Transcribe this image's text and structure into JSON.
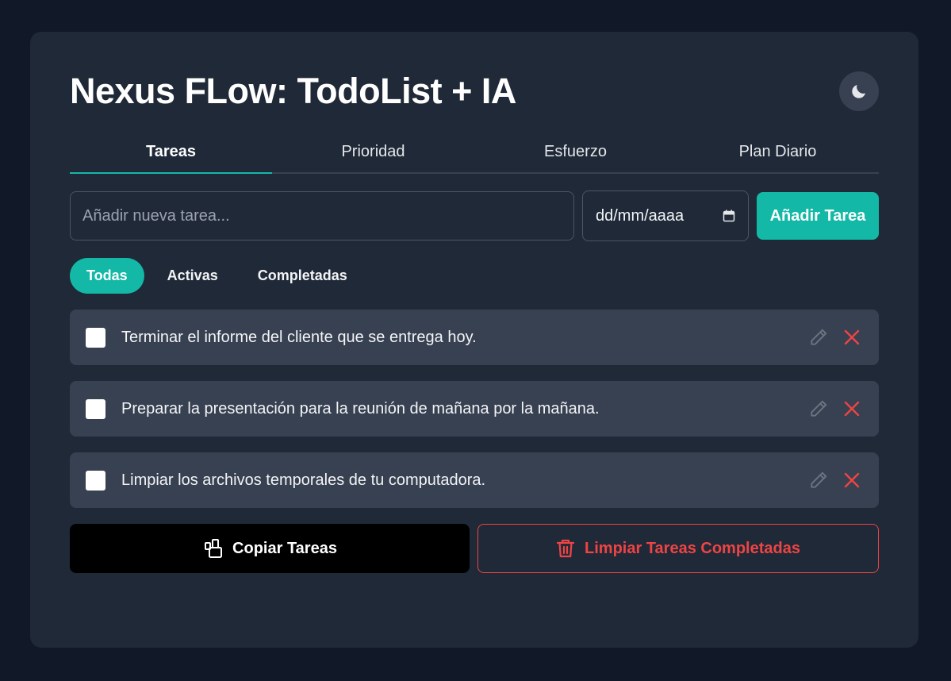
{
  "app": {
    "title": "Nexus FLow: TodoList + IA"
  },
  "theme_toggle": {
    "icon": "moon-icon"
  },
  "tabs": [
    {
      "label": "Tareas",
      "active": true
    },
    {
      "label": "Prioridad",
      "active": false
    },
    {
      "label": "Esfuerzo",
      "active": false
    },
    {
      "label": "Plan Diario",
      "active": false
    }
  ],
  "add_task": {
    "placeholder": "Añadir nueva tarea...",
    "value": "",
    "date_placeholder": "dd/mm/aaaa",
    "button_label": "Añadir Tarea"
  },
  "filters": [
    {
      "label": "Todas",
      "active": true
    },
    {
      "label": "Activas",
      "active": false
    },
    {
      "label": "Completadas",
      "active": false
    }
  ],
  "tasks": [
    {
      "text": "Terminar el informe del cliente que se entrega hoy.",
      "completed": false
    },
    {
      "text": "Preparar la presentación para la reunión de mañana por la mañana.",
      "completed": false
    },
    {
      "text": "Limpiar los archivos temporales de tu computadora.",
      "completed": false
    }
  ],
  "actions": {
    "copy_label": "Copiar Tareas",
    "clear_label": "Limpiar Tareas Completadas"
  },
  "colors": {
    "background": "#111827",
    "card": "#1f2937",
    "accent": "#14b8a6",
    "danger": "#ef4444",
    "item": "#374151"
  }
}
